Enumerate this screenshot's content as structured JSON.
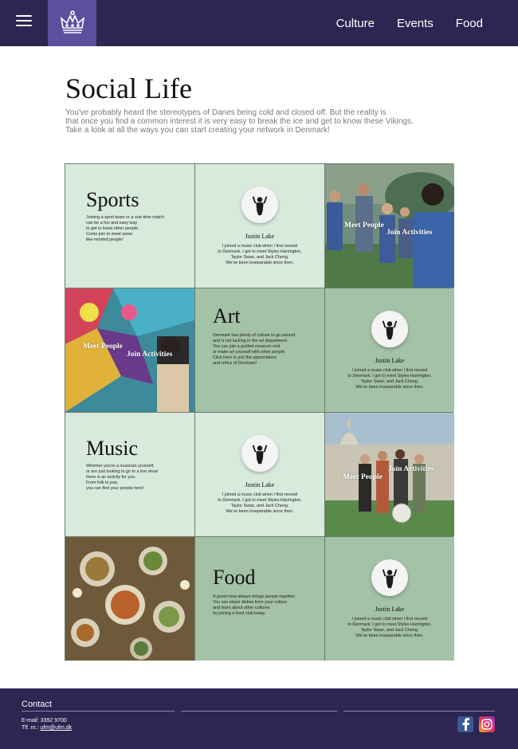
{
  "nav": {
    "items": [
      "Culture",
      "Events",
      "Food"
    ]
  },
  "header": {
    "title": "Social Life",
    "intro": [
      "You've probably heard the stereotypes of Danes being cold and closed off. But the reality is",
      " that once you find a common interest it is very easy to break the ice and get to know these Vikings.",
      "Take a look at all the ways you can start creating your network in Denmark!"
    ]
  },
  "categories": [
    {
      "title": "Sports",
      "desc": [
        "Joining a sport team or a one-time match",
        "can be a fun and  easy way",
        " to get to know other people.",
        "Come join to meet some",
        "like-minded people!"
      ]
    },
    {
      "title": "Art",
      "desc": [
        "Denmark has plenty of culture to go around",
        "and is not lacking in the art department.",
        "You can join a guided museum visit",
        " or make art yourself with other people.",
        "Click here to join the appreciators",
        "and critics of Denmark!"
      ]
    },
    {
      "title": "Music",
      "desc": [
        "Whether you're a musician yourself,",
        "or are just looking to go to a live show",
        " there is an activity for you.",
        "From folk to pop,",
        "you can find your people here!"
      ]
    },
    {
      "title": "Food",
      "desc": [
        "A good meal always brings people together.",
        "You can share dishes from your culture",
        "and learn about other cultures",
        "by joining a food club today."
      ]
    }
  ],
  "testimonial": {
    "name": "Justin Lake",
    "quote": [
      "I joined a music club when I first moved",
      "to Denmark. I got to meet Styles Harrington,",
      "Taylor Swan, and Jack Cheng.",
      "We've been inseparable since then."
    ]
  },
  "overlays": {
    "meet": "Meet People",
    "join": "Join Activities"
  },
  "footer": {
    "contact_title": "Contact",
    "email": "E-mail: 3392 9700",
    "phone_prefix": "Tlf. nr.: ",
    "phone_link": "ufm@ufm.dk"
  },
  "colors": {
    "brand": "#2d2552",
    "logo_bg": "#5e4f9e",
    "light_tile": "#d8eadb",
    "mid_tile": "#a3c2a6"
  },
  "icons": [
    "menu-icon",
    "crown-logo-icon",
    "person-silhouette-icon",
    "facebook-icon",
    "instagram-icon"
  ]
}
